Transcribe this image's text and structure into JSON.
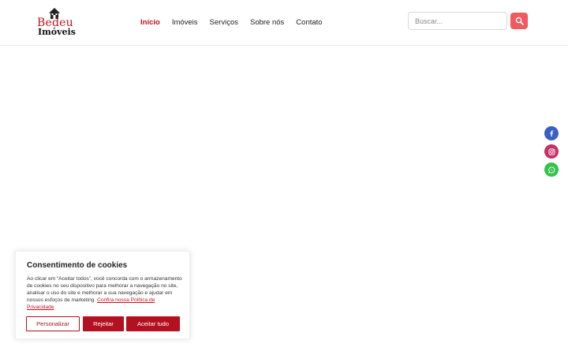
{
  "logo": {
    "line1": "Bedeu",
    "line2": "Imóveis",
    "icon": "house-icon"
  },
  "nav": {
    "items": [
      {
        "label": "Início",
        "active": true
      },
      {
        "label": "Imóveis",
        "active": false
      },
      {
        "label": "Serviços",
        "active": false
      },
      {
        "label": "Sobre nós",
        "active": false
      },
      {
        "label": "Contato",
        "active": false
      }
    ]
  },
  "search": {
    "placeholder": "Buscar...",
    "button_icon": "search-icon"
  },
  "social": [
    {
      "name": "facebook",
      "icon": "facebook-icon",
      "color": "#3b5fc4"
    },
    {
      "name": "instagram",
      "icon": "instagram-icon",
      "color": "#c43069"
    },
    {
      "name": "whatsapp",
      "icon": "whatsapp-icon",
      "color": "#35c24a"
    }
  ],
  "cookie": {
    "title": "Consentimento de cookies",
    "text": " Ao clicar em “Aceitar todos”, você concorda com o armazenamento de cookies no seu dispositivo para melhorar a navegação no site, analisar o uso do site e melhorar a sua navegação e ajudar em nossos esfoços de marketing. ",
    "link_text": "Confira nossa Política de Privacidade",
    "buttons": {
      "customize": "Personalizar",
      "reject": "Rejeitar",
      "accept": "Aceitar tudo"
    }
  },
  "colors": {
    "brand_red": "#c0121e",
    "button_red": "#b3111f",
    "search_button": "#ef5a5f"
  }
}
